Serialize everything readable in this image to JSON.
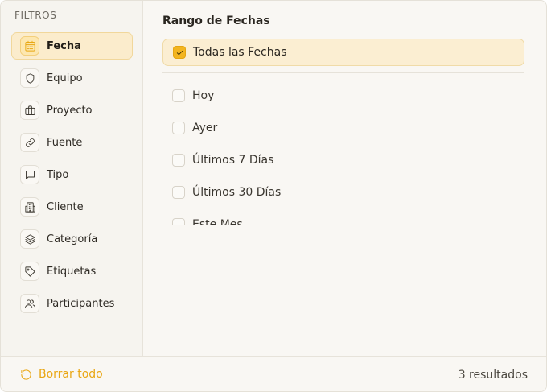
{
  "sidebar": {
    "title": "FILTROS",
    "items": [
      {
        "label": "Fecha",
        "icon": "calendar-icon",
        "active": true
      },
      {
        "label": "Equipo",
        "icon": "shield-icon",
        "active": false
      },
      {
        "label": "Proyecto",
        "icon": "briefcase-icon",
        "active": false
      },
      {
        "label": "Fuente",
        "icon": "link-icon",
        "active": false
      },
      {
        "label": "Tipo",
        "icon": "message-square-icon",
        "active": false
      },
      {
        "label": "Cliente",
        "icon": "building-icon",
        "active": false
      },
      {
        "label": "Categoría",
        "icon": "layers-icon",
        "active": false
      },
      {
        "label": "Etiquetas",
        "icon": "tag-icon",
        "active": false
      },
      {
        "label": "Participantes",
        "icon": "users-icon",
        "active": false
      }
    ]
  },
  "main": {
    "section_title": "Rango de Fechas",
    "all_option": {
      "label": "Todas las Fechas",
      "checked": true
    },
    "options": [
      {
        "label": "Hoy",
        "checked": false
      },
      {
        "label": "Ayer",
        "checked": false
      },
      {
        "label": "Últimos 7 Días",
        "checked": false
      },
      {
        "label": "Últimos 30 Días",
        "checked": false
      },
      {
        "label": "Este Mes",
        "checked": false
      }
    ]
  },
  "footer": {
    "clear_label": "Borrar todo",
    "clear_icon": "rotate-ccw-icon",
    "results_text": "3 resultados"
  },
  "colors": {
    "accent": "#f3b51f",
    "accent_text": "#e9a612",
    "active_bg": "#fbeccc",
    "panel_bg": "#f9f7f3"
  }
}
